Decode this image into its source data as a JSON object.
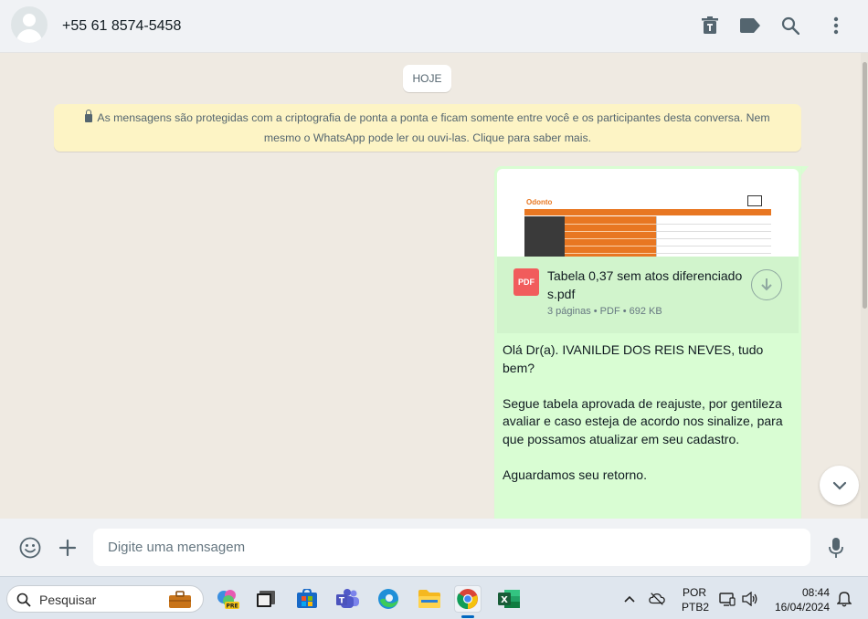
{
  "header": {
    "contact_name": "+55 61 8574-5458"
  },
  "chat": {
    "day_label": "HOJE",
    "encryption_notice": "As mensagens são protegidas com a criptografia de ponta a ponta e ficam somente entre você e os participantes desta conversa. Nem mesmo o WhatsApp pode ler ou ouvi-las. Clique para saber mais.",
    "message": {
      "document": {
        "icon_label": "PDF",
        "name": "Tabela 0,37 sem atos diferenciados.pdf",
        "meta": "3 páginas • PDF • 692 KB"
      },
      "text": "Olá Dr(a). IVANILDE DOS REIS NEVES, tudo bem?\n\nSegue tabela aprovada de reajuste, por gentileza avaliar e caso esteja de acordo nos sinalize, para que possamos atualizar em seu cadastro.\n\nAguardamos seu retorno."
    }
  },
  "composer": {
    "placeholder": "Digite uma mensagem"
  },
  "taskbar": {
    "search_label": "Pesquisar",
    "language_top": "POR",
    "language_bottom": "PTB2",
    "time": "08:44",
    "date": "16/04/2024"
  },
  "colors": {
    "bubble_out": "#d9fdd3",
    "chat_bg": "#efeae2",
    "notice_bg": "#fdf4c5",
    "pdf_red": "#f15c5c"
  }
}
